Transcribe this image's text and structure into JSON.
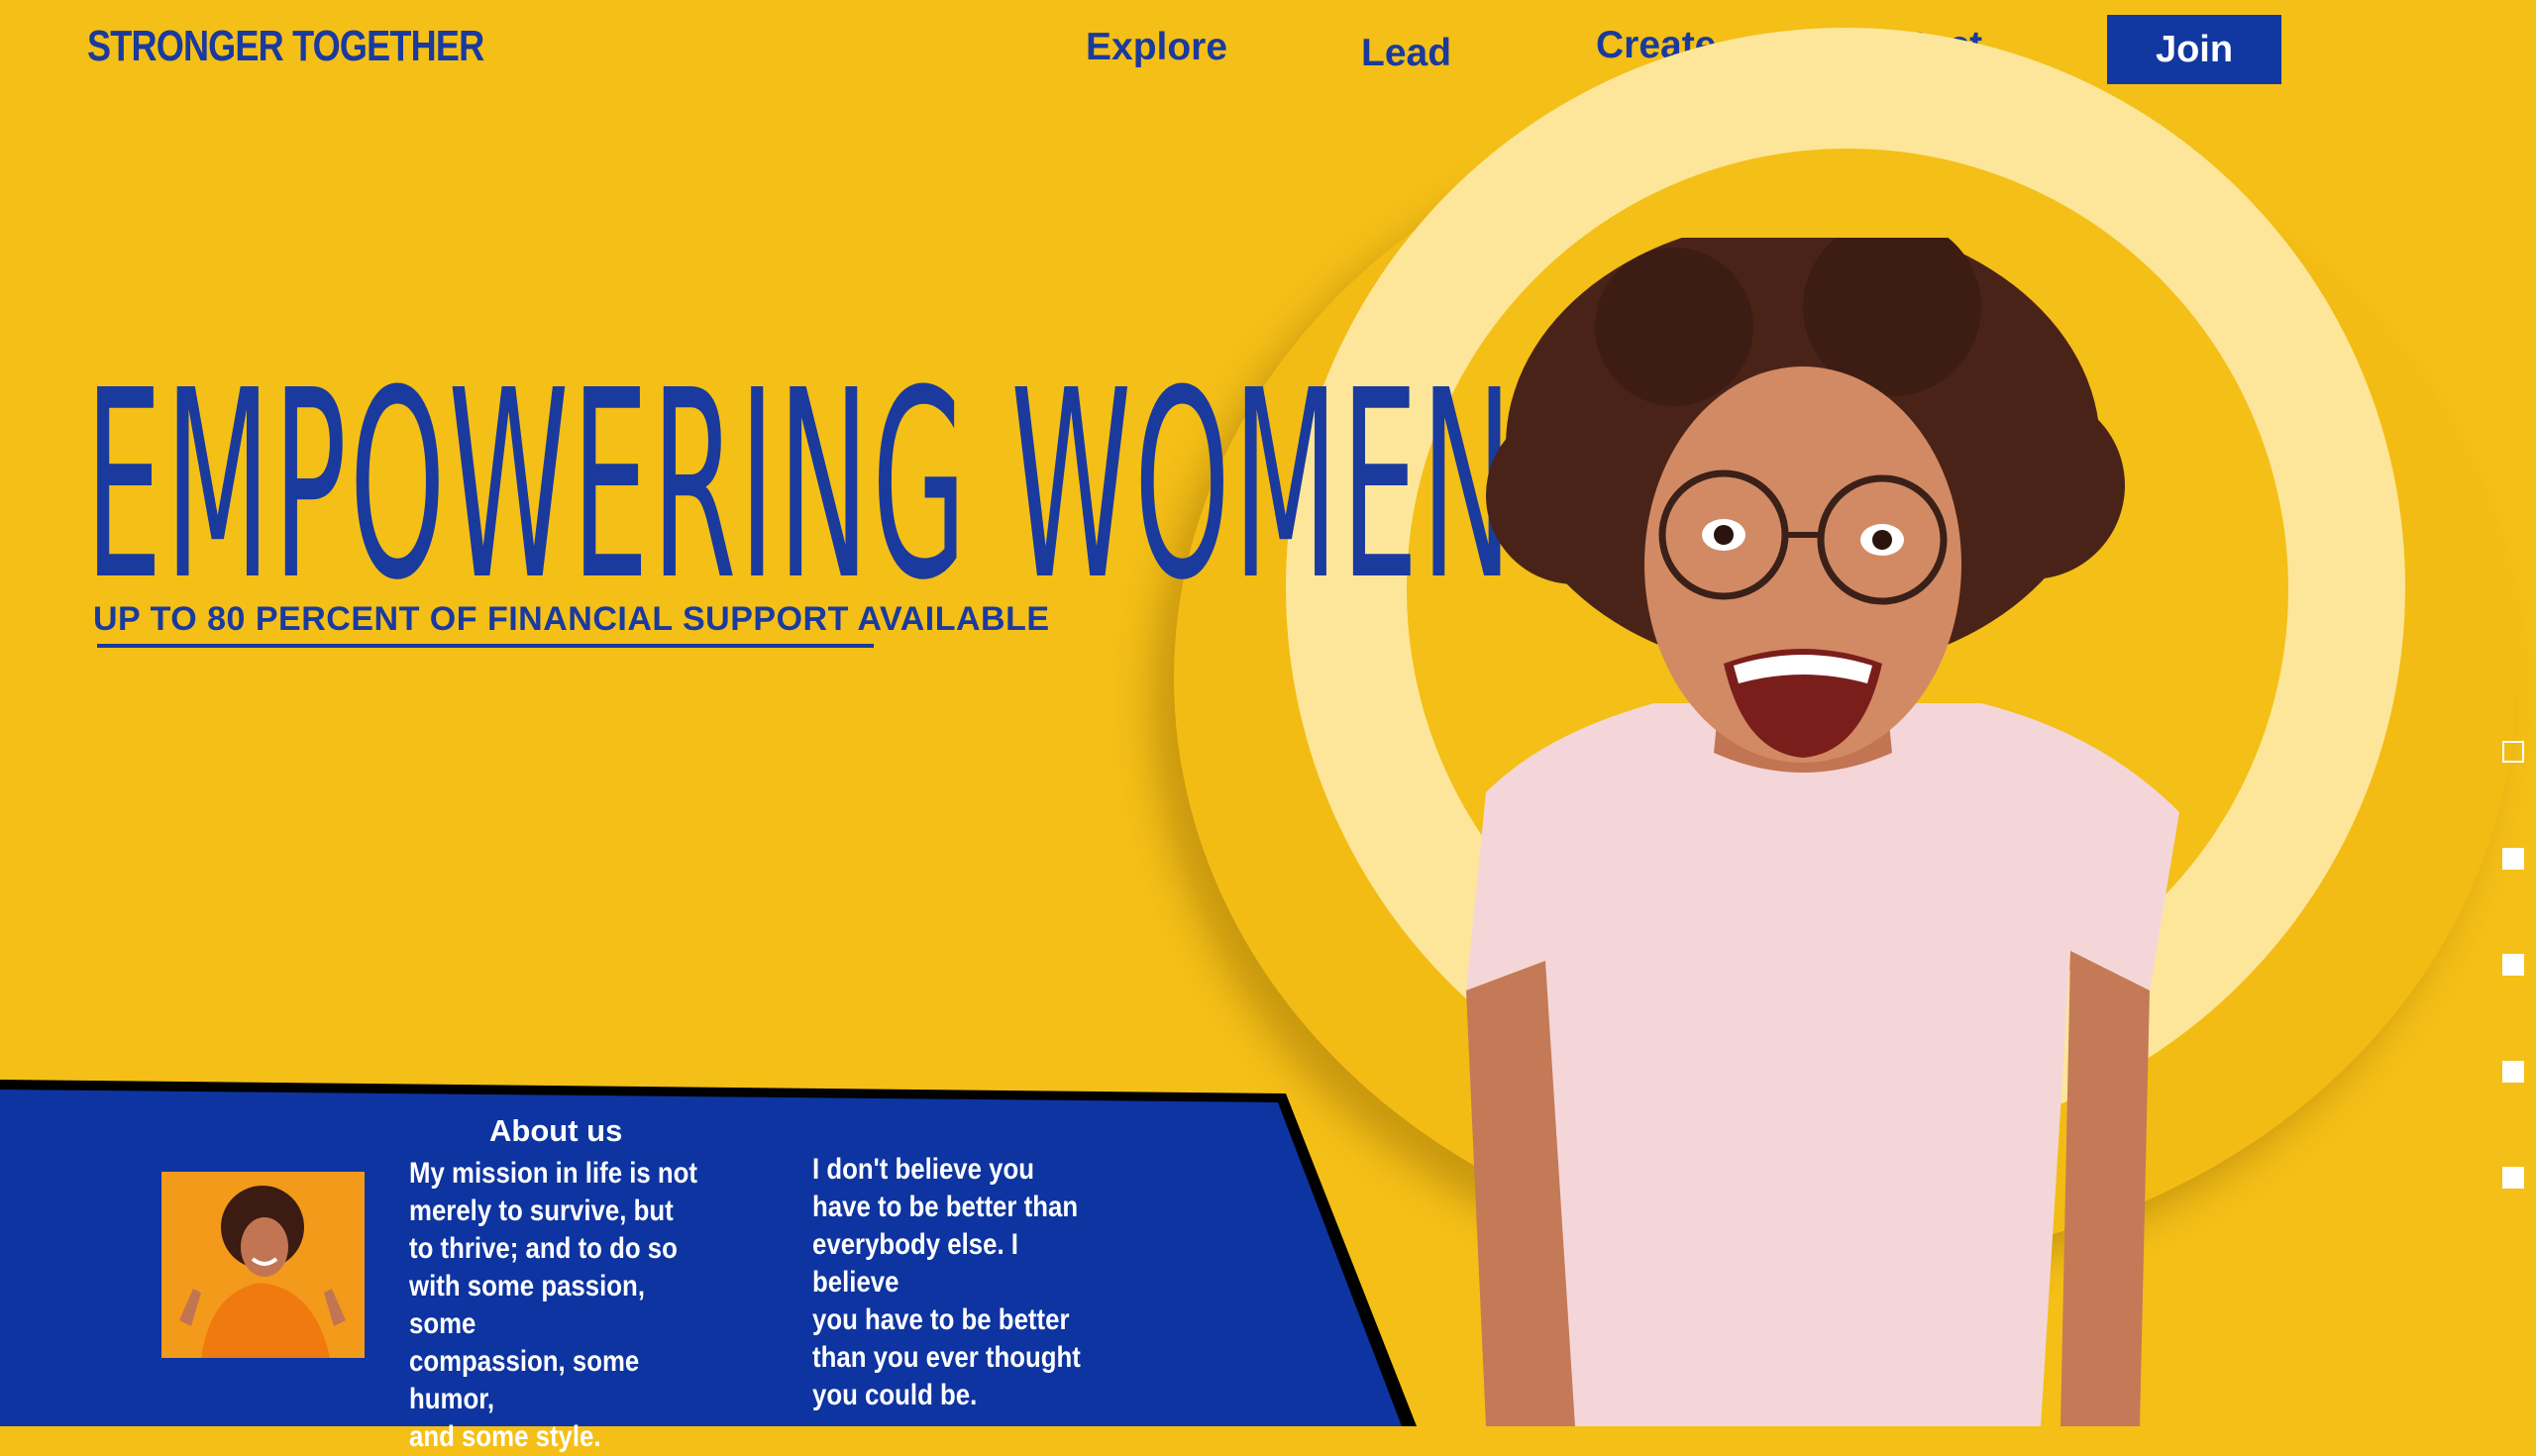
{
  "brand": {
    "name": "STRONGER TOGETHER"
  },
  "nav": {
    "items": [
      "Explore",
      "Lead",
      "Create",
      "Contact"
    ],
    "join_label": "Join"
  },
  "hero": {
    "title": "EMPOWERING WOMEN",
    "subtitle": "UP TO 80 PERCENT OF FINANCIAL SUPPORT AVAILABLE"
  },
  "about": {
    "title": "About us",
    "paragraph_1_lines": [
      "My mission in life is not",
      "merely to survive, but",
      "to thrive; and to do so",
      "with some passion, some",
      "compassion, some humor,",
      "and some style."
    ],
    "paragraph_2_lines": [
      "I don't believe you",
      "have to be better than",
      "everybody else. I believe",
      "you have to be better",
      "than you ever thought",
      "you could be."
    ]
  },
  "pager": {
    "count": 5,
    "active_index": 0
  },
  "colors": {
    "background": "#f4bf17",
    "brand_blue": "#1137a0",
    "ring_pale": "#fde69a",
    "text_white": "#ffffff"
  }
}
